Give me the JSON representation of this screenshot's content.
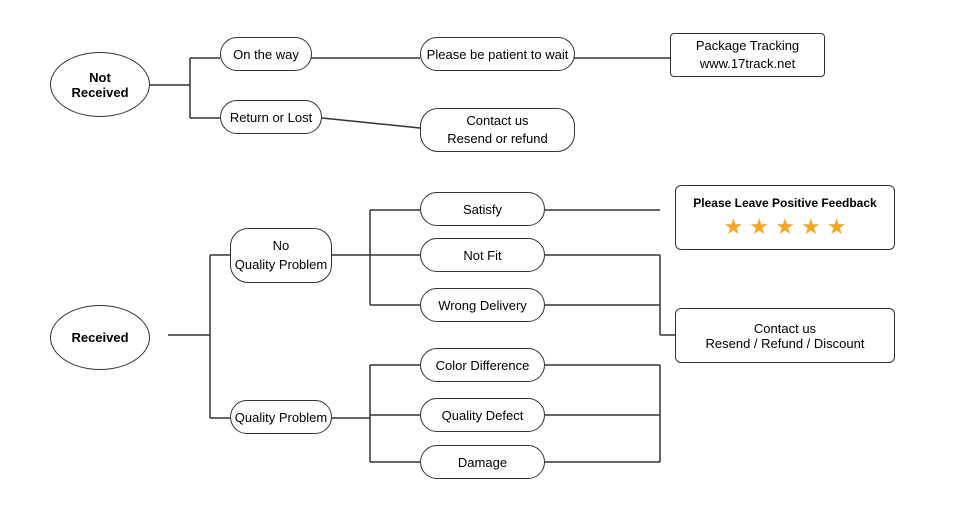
{
  "nodes": {
    "not_received": {
      "label": "Not\nReceived"
    },
    "on_the_way": {
      "label": "On the way"
    },
    "return_or_lost": {
      "label": "Return or Lost"
    },
    "be_patient": {
      "label": "Please be patient to wait"
    },
    "package_tracking": {
      "label": "Package Tracking\nwww.17track.net"
    },
    "contact_resend_refund": {
      "label": "Contact us\nResend or refund"
    },
    "received": {
      "label": "Received"
    },
    "no_quality_problem": {
      "label": "No\nQuality Problem"
    },
    "quality_problem": {
      "label": "Quality Problem"
    },
    "satisfy": {
      "label": "Satisfy"
    },
    "not_fit": {
      "label": "Not Fit"
    },
    "wrong_delivery": {
      "label": "Wrong Delivery"
    },
    "color_difference": {
      "label": "Color Difference"
    },
    "quality_defect": {
      "label": "Quality Defect"
    },
    "damage": {
      "label": "Damage"
    },
    "feedback": {
      "label": "Please Leave Positive Feedback",
      "stars": "★ ★ ★ ★ ★"
    },
    "contact_resend_refund_discount": {
      "label": "Contact us\nResend / Refund / Discount"
    }
  }
}
